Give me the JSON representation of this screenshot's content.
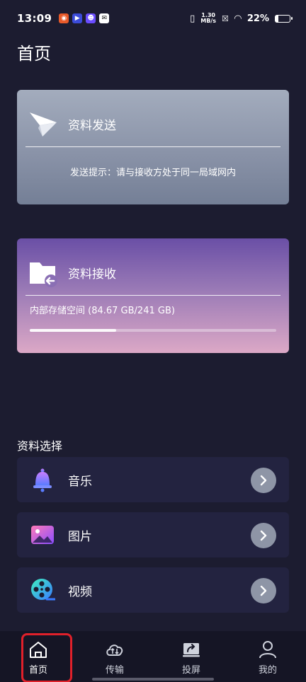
{
  "status_bar": {
    "time": "13:09",
    "net_speed_value": "1.30",
    "net_speed_unit": "MB/s",
    "battery_percent": "22%",
    "battery_level": 0.22
  },
  "page": {
    "title": "首页"
  },
  "send_card": {
    "title": "资料发送",
    "tip": "发送提示：请与接收方处于同一局域网内"
  },
  "receive_card": {
    "title": "资料接收",
    "storage": "内部存储空间 (84.67 GB/241 GB)",
    "storage_fraction": 0.35
  },
  "selection": {
    "title": "资料选择",
    "items": [
      {
        "label": "音乐",
        "icon": "bell-music-icon"
      },
      {
        "label": "图片",
        "icon": "picture-icon"
      },
      {
        "label": "视频",
        "icon": "film-reel-icon"
      }
    ]
  },
  "nav": {
    "items": [
      {
        "label": "首页",
        "icon": "home-icon",
        "active": true
      },
      {
        "label": "传输",
        "icon": "cloud-transfer-icon",
        "active": false
      },
      {
        "label": "投屏",
        "icon": "screen-cast-icon",
        "active": false
      },
      {
        "label": "我的",
        "icon": "user-icon",
        "active": false
      }
    ]
  },
  "colors": {
    "background": "#1c1c30",
    "highlight": "#e0202a",
    "arrow_button": "#8e95a6"
  }
}
